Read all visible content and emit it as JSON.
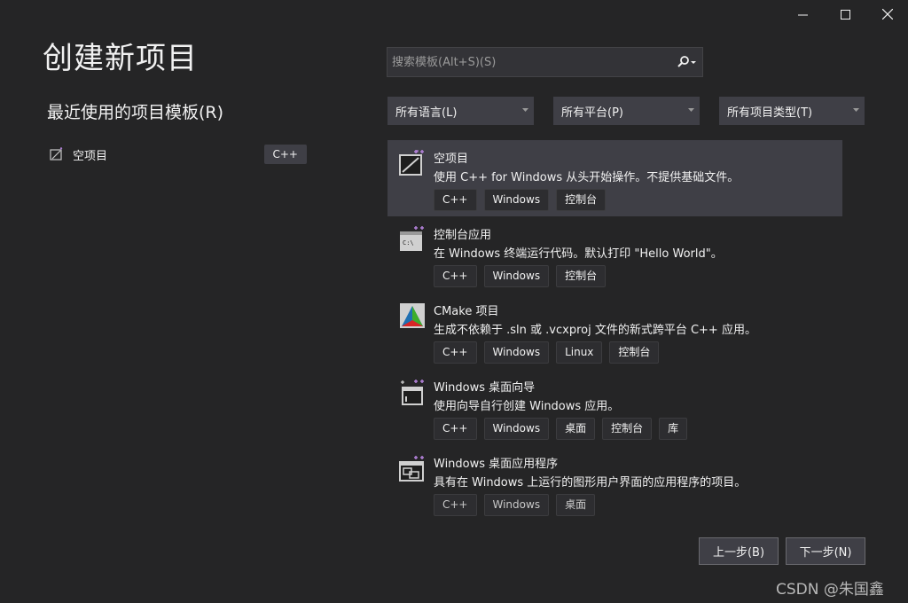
{
  "window": {
    "controls": [
      "minimize-icon",
      "maximize-icon",
      "close-icon"
    ]
  },
  "page_title": "创建新项目",
  "recent": {
    "title": "最近使用的项目模板(R)",
    "items": [
      {
        "label": "空项目",
        "tag": "C++",
        "icon": "empty-project-icon"
      }
    ]
  },
  "search": {
    "placeholder": "搜索模板(Alt+S)(S)",
    "value": ""
  },
  "filters": {
    "language": "所有语言(L)",
    "platform": "所有平台(P)",
    "project_type": "所有项目类型(T)"
  },
  "templates": [
    {
      "name": "空项目",
      "description": "使用 C++ for Windows 从头开始操作。不提供基础文件。",
      "tags": [
        "C++",
        "Windows",
        "控制台"
      ],
      "icon": "empty-project-icon",
      "selected": true
    },
    {
      "name": "控制台应用",
      "description": "在 Windows 终端运行代码。默认打印 \"Hello World\"。",
      "tags": [
        "C++",
        "Windows",
        "控制台"
      ],
      "icon": "console-app-icon"
    },
    {
      "name": "CMake 项目",
      "description": "生成不依赖于 .sln 或 .vcxproj 文件的新式跨平台 C++ 应用。",
      "tags": [
        "C++",
        "Windows",
        "Linux",
        "控制台"
      ],
      "icon": "cmake-icon"
    },
    {
      "name": "Windows 桌面向导",
      "description": "使用向导自行创建 Windows 应用。",
      "tags": [
        "C++",
        "Windows",
        "桌面",
        "控制台",
        "库"
      ],
      "icon": "desktop-wizard-icon"
    },
    {
      "name": "Windows 桌面应用程序",
      "description": "具有在 Windows 上运行的图形用户界面的应用程序的项目。",
      "tags": [
        "C++",
        "Windows",
        "桌面"
      ],
      "icon": "desktop-app-icon"
    }
  ],
  "buttons": {
    "back": "上一步(B)",
    "next": "下一步(N)"
  },
  "watermark": "CSDN @朱国鑫",
  "colors": {
    "background": "#252526",
    "panel": "#3f3f46",
    "accent_purple": "#b180d7",
    "text": "#f1f1f1"
  }
}
